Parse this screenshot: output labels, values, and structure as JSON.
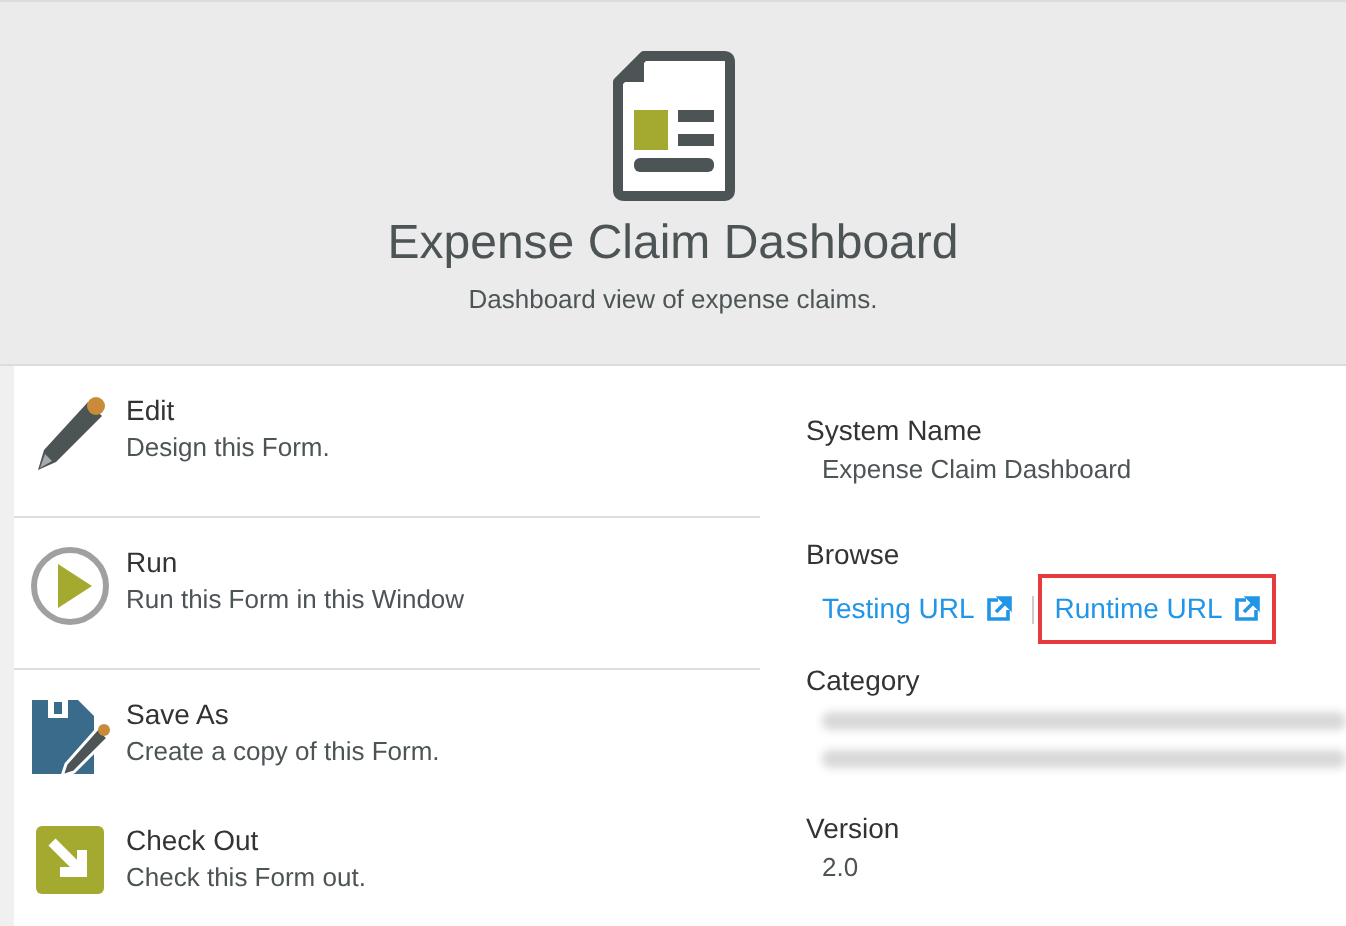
{
  "header": {
    "title": "Expense Claim Dashboard",
    "subtitle": "Dashboard view of expense claims."
  },
  "actions": [
    {
      "kind": "edit",
      "title": "Edit",
      "description": "Design this Form.",
      "divider": true
    },
    {
      "kind": "run",
      "title": "Run",
      "description": "Run this Form in this Window",
      "divider": true
    },
    {
      "kind": "save-as",
      "title": "Save As",
      "description": "Create a copy of this Form.",
      "divider": false
    },
    {
      "kind": "check-out",
      "title": "Check Out",
      "description": "Check this Form out.",
      "divider": false
    }
  ],
  "details": {
    "system_name": {
      "label": "System Name",
      "value": "Expense Claim Dashboard"
    },
    "browse": {
      "label": "Browse",
      "links": [
        {
          "label": "Testing URL",
          "highlighted": false
        },
        {
          "label": "Runtime URL",
          "highlighted": true
        }
      ]
    },
    "category": {
      "label": "Category",
      "redacted": true
    },
    "version": {
      "label": "Version",
      "value": "2.0"
    }
  }
}
